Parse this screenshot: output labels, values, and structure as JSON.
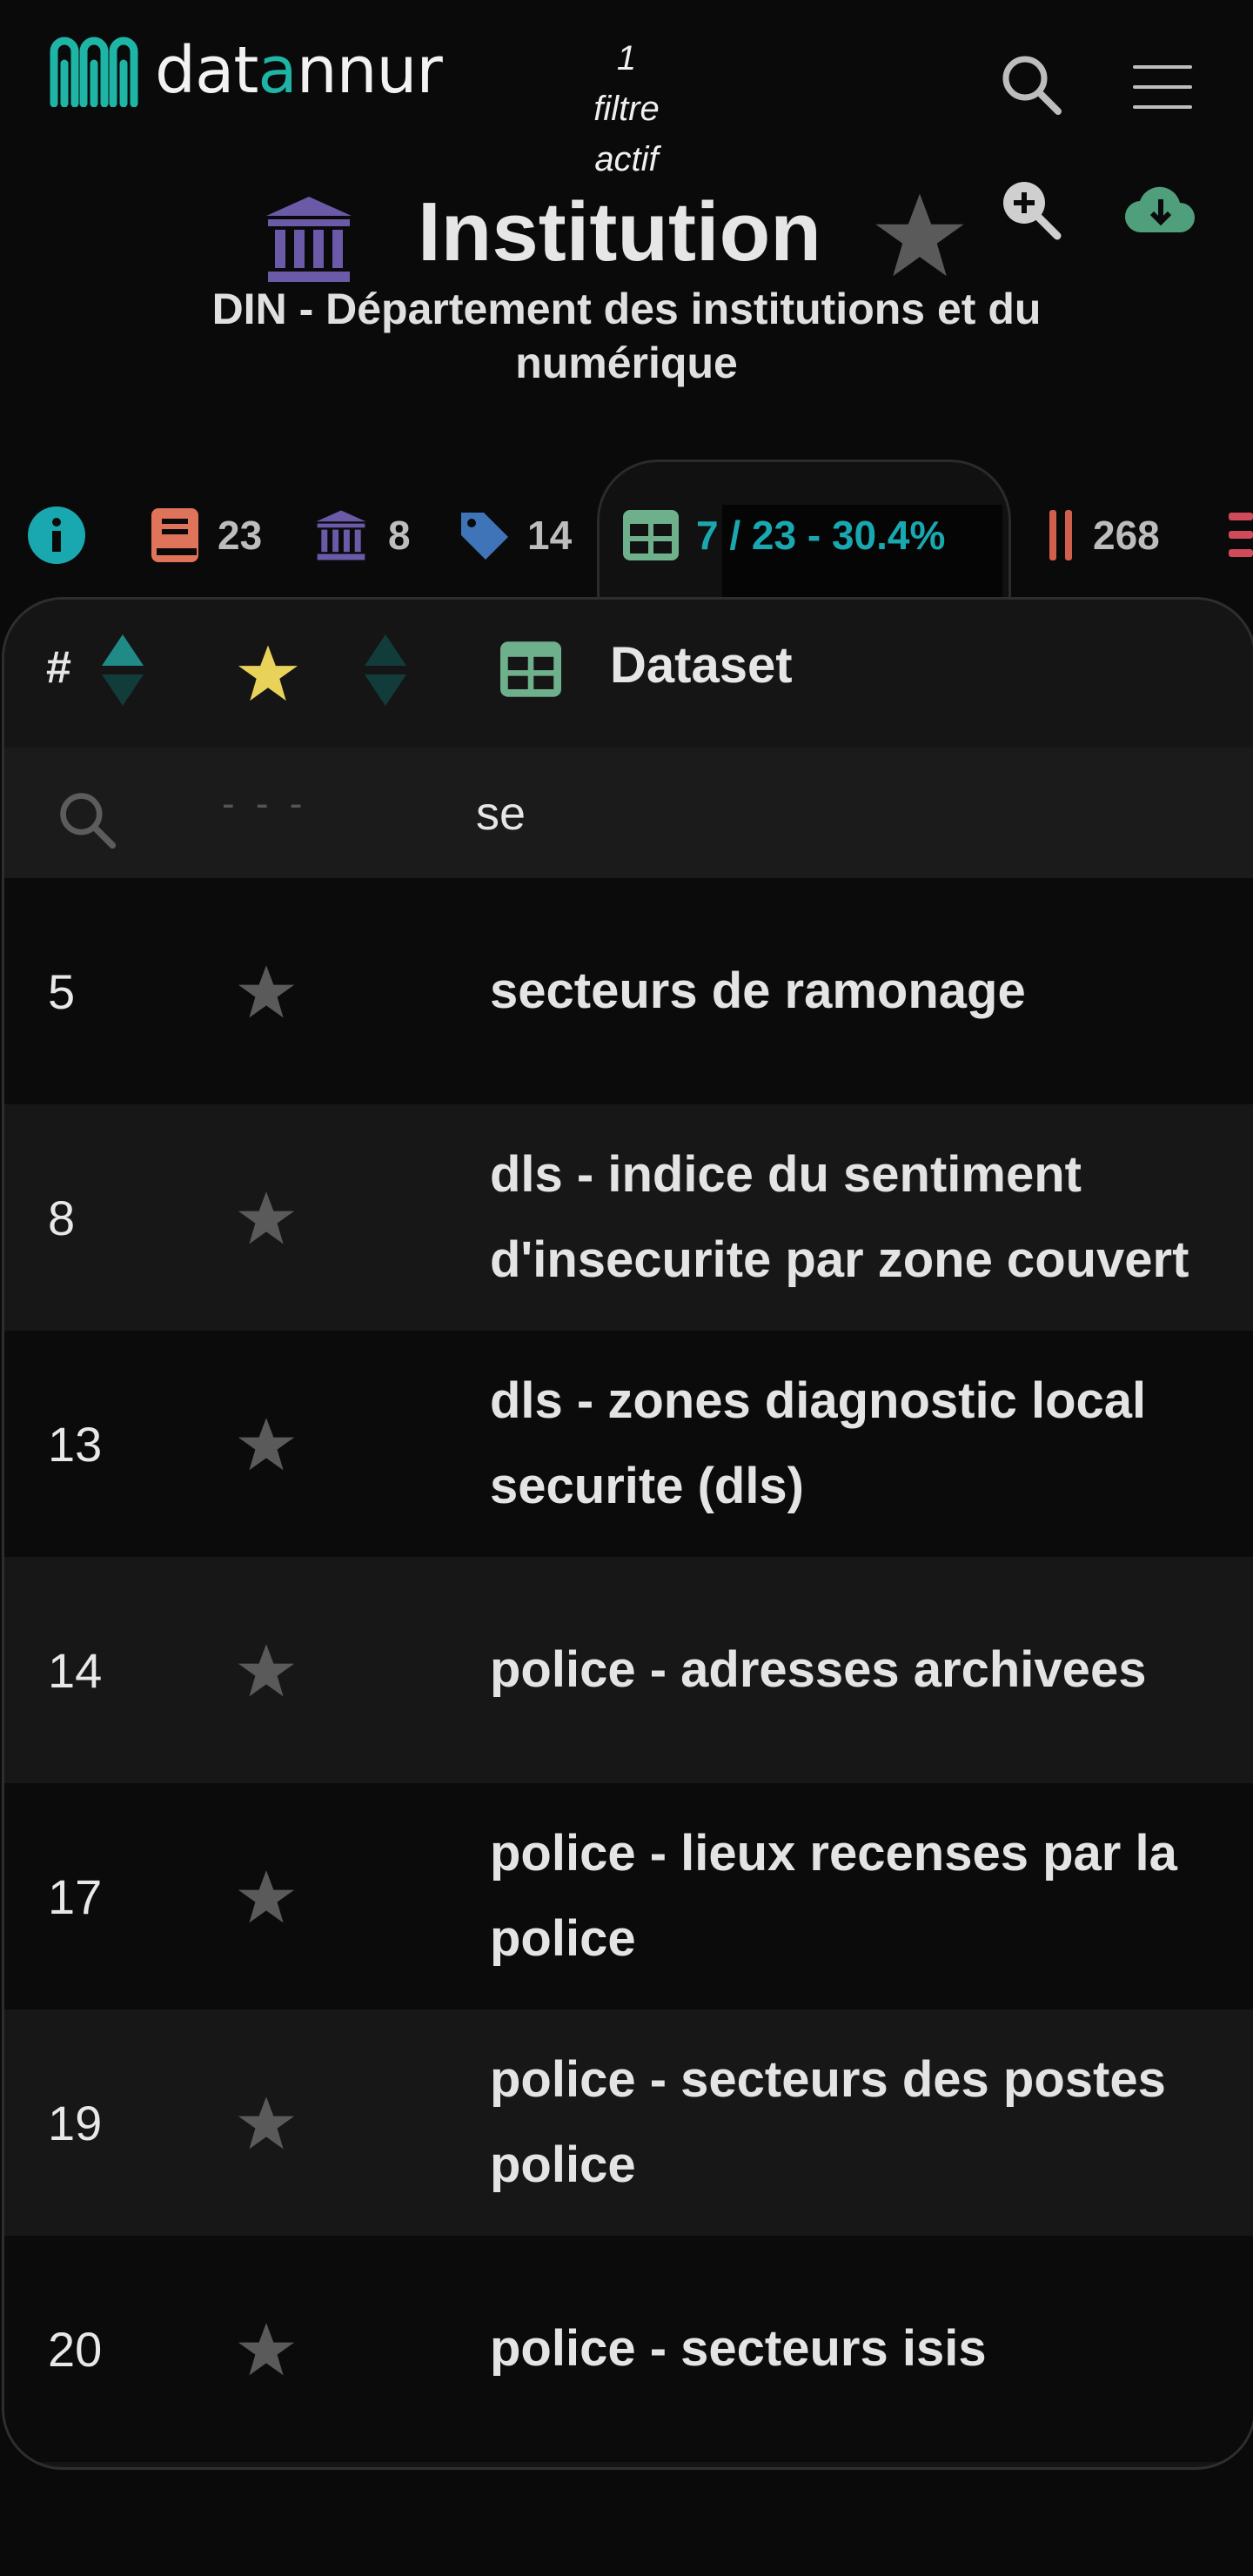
{
  "header": {
    "logo": {
      "text_prefix": "dat",
      "text_accent": "a",
      "text_suffix": "nnur"
    },
    "filter_status": [
      "1",
      "filtre",
      "actif"
    ],
    "entity_type": "Institution",
    "title": "Institution",
    "subtitle": "DIN - Département des institutions et du numérique"
  },
  "tabs": [
    {
      "icon": "info-icon",
      "count": ""
    },
    {
      "icon": "book-icon",
      "count": "23"
    },
    {
      "icon": "institution-icon",
      "count": "8"
    },
    {
      "icon": "tag-icon",
      "count": "14"
    },
    {
      "icon": "table-icon",
      "count": "7 / 23 - 30.4%",
      "active": true
    },
    {
      "icon": "columns-icon",
      "count": "268"
    },
    {
      "icon": "list-icon",
      "count": ""
    }
  ],
  "table": {
    "headers": {
      "number": "#",
      "name": "Dataset"
    },
    "filter": {
      "fav_placeholder": "- - -",
      "search_value": "se"
    },
    "rows": [
      {
        "number": "5",
        "name": [
          "secteurs de ramonage"
        ]
      },
      {
        "number": "8",
        "name": [
          "dls - indice du sentiment",
          "d'insecurite par zone couvert"
        ]
      },
      {
        "number": "13",
        "name": [
          "dls - zones diagnostic local",
          "securite (dls)"
        ]
      },
      {
        "number": "14",
        "name": [
          "police - adresses archivees"
        ]
      },
      {
        "number": "17",
        "name": [
          "police - lieux recenses par la",
          "police"
        ]
      },
      {
        "number": "19",
        "name": [
          "police - secteurs des postes",
          "police"
        ]
      },
      {
        "number": "20",
        "name": [
          "police - secteurs isis"
        ]
      }
    ]
  },
  "colors": {
    "background": "#0a0a0a",
    "accent_teal": "#1fb5a6",
    "active_tab_text": "#1aa8b0",
    "institution_purple": "#6a5aa8",
    "book_orange": "#e0745a",
    "tag_blue": "#3f74b8",
    "table_green": "#6fb08c",
    "columns_red": "#d0604c",
    "download_green": "#4f9e7c",
    "favorite_yellow": "#e8d25a",
    "star_grey": "#5a5a5a"
  }
}
